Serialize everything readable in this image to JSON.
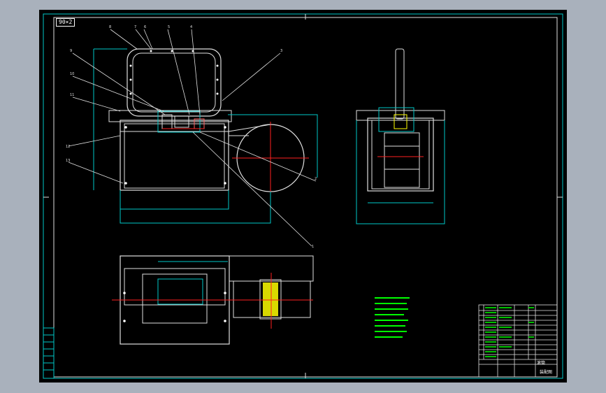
{
  "drawing": {
    "scale_stamp": "90×2",
    "callouts": [
      "8",
      "7",
      "6",
      "5",
      "4",
      "3",
      "9",
      "10",
      "11",
      "12",
      "13",
      "2",
      "1"
    ],
    "title_block": {
      "name": "滚筒",
      "sub": "装配图"
    }
  },
  "colors": {
    "background": "#000000",
    "frame": "#00c8c8",
    "geometry": "#ffffff",
    "dimensions": "#00c8c8",
    "centerline": "#ff2020",
    "notes": "#00ff00",
    "hatch": "#ffff00",
    "window": "#a9b1bc"
  }
}
